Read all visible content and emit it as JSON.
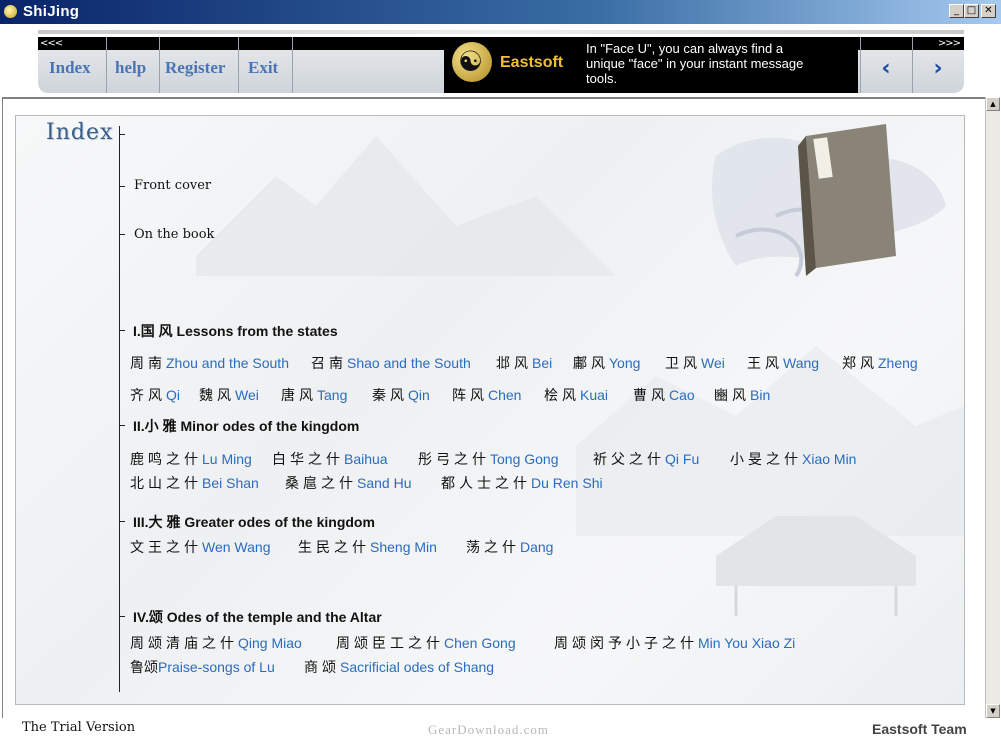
{
  "window": {
    "title": "ShiJing",
    "min_glyph": "_",
    "max_glyph": "□",
    "close_glyph": "✕"
  },
  "nav": {
    "arrows_left": "<<<",
    "arrows_right": ">>>",
    "items": [
      {
        "label": "Index"
      },
      {
        "label": "help"
      },
      {
        "label": "Register"
      },
      {
        "label": "Exit"
      }
    ],
    "prev_glyph": "‹",
    "next_glyph": "›"
  },
  "ad": {
    "brand": "Eastsoft",
    "text": "In \"Face U\", you can always find a unique \"face\" in your instant message tools."
  },
  "index": {
    "title": "Index",
    "front_cover": "Front cover",
    "on_the_book": "On the book",
    "sections": [
      {
        "heading": "I.国 风 Lessons from the states",
        "entries": [
          {
            "zh": "周南",
            "en": "Zhou and the South"
          },
          {
            "zh": "召南",
            "en": "Shao and the South"
          },
          {
            "zh": "邶风",
            "en": "Bei"
          },
          {
            "zh": "鄘风",
            "en": "Yong"
          },
          {
            "zh": "卫风",
            "en": "Wei"
          },
          {
            "zh": "王风",
            "en": "Wang"
          },
          {
            "zh": "郑风",
            "en": "Zheng"
          },
          {
            "zh": "齐风",
            "en": "Qi"
          },
          {
            "zh": "魏风",
            "en": "Wei"
          },
          {
            "zh": "唐风",
            "en": "Tang"
          },
          {
            "zh": "秦风",
            "en": "Qin"
          },
          {
            "zh": "阵风",
            "en": "Chen"
          },
          {
            "zh": "桧风",
            "en": "Kuai"
          },
          {
            "zh": "曹风",
            "en": "Cao"
          },
          {
            "zh": "豳风",
            "en": "Bin"
          }
        ]
      },
      {
        "heading": "II.小 雅 Minor odes of the kingdom",
        "entries": [
          {
            "zh": "鹿鸣之什",
            "en": "Lu Ming"
          },
          {
            "zh": "白华之什",
            "en": "Baihua"
          },
          {
            "zh": "彤弓之什",
            "en": "Tong Gong"
          },
          {
            "zh": "祈父之什",
            "en": "Qi Fu"
          },
          {
            "zh": "小旻之什",
            "en": "Xiao Min"
          },
          {
            "zh": "北山之什",
            "en": "Bei Shan"
          },
          {
            "zh": "桑扈之什",
            "en": "Sand Hu"
          },
          {
            "zh": "都人士之什",
            "en": "Du Ren Shi"
          }
        ]
      },
      {
        "heading": "III.大 雅 Greater odes of the kingdom",
        "entries": [
          {
            "zh": "文王之什",
            "en": "Wen Wang"
          },
          {
            "zh": "生民之什",
            "en": "Sheng Min"
          },
          {
            "zh": "荡之什",
            "en": "Dang"
          }
        ]
      },
      {
        "heading": "IV.颂 Odes of the temple and the Altar",
        "entries": [
          {
            "zh": "周颂清庙之什",
            "en": "Qing Miao"
          },
          {
            "zh": "周颂臣工之什",
            "en": "Chen Gong"
          },
          {
            "zh": "周颂闵予小子之什",
            "en": "Min You Xiao Zi"
          },
          {
            "zh": "鲁颂",
            "en": "Praise-songs of Lu"
          },
          {
            "zh": "商颂",
            "en": "Sacrificial odes of Shang"
          }
        ]
      }
    ]
  },
  "status": {
    "trial": "The Trial Version",
    "watermark": "GearDownload.com",
    "team": "Eastsoft Team"
  },
  "colors": {
    "link": "#2a6cc0",
    "title_bar": "#0a246a",
    "brand": "#f0c030",
    "nav_text": "#4a74b4"
  }
}
